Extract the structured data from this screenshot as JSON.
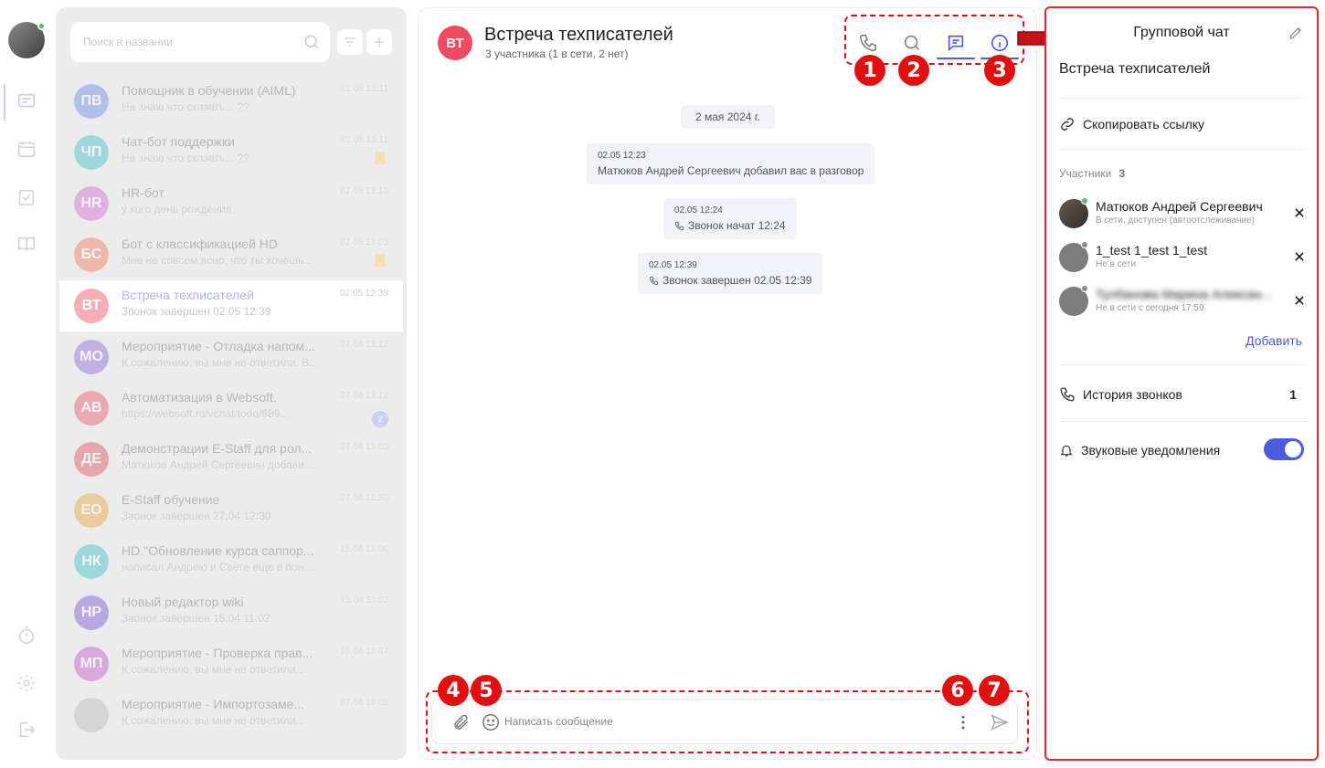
{
  "colors": {
    "accent": "#4a5ce0",
    "annotation_red": "#e01010",
    "online": "#4fc06a",
    "active_chat_avatar": "#ef4b5e"
  },
  "rail": {
    "icons": [
      "chat-icon",
      "calendar-icon",
      "tasks-icon",
      "book-icon",
      "timer-icon",
      "gear-icon",
      "logout-icon"
    ]
  },
  "chat_list": {
    "search_placeholder": "Поиск в названии",
    "items": [
      {
        "initials": "ПВ",
        "name": "Помощник в обучении (AIML)",
        "preview": "Не знаю что сказать... ??",
        "time": "02.05 13:11",
        "color": "#6b8bf0"
      },
      {
        "initials": "ЧП",
        "name": "Чат-бот поддержки",
        "preview": "Не знаю что сказать... ??",
        "time": "02.05 13:11",
        "color": "#3ec4c9",
        "bookmark": true
      },
      {
        "initials": "HR",
        "name": "HR-бот",
        "preview": "у кого день рождения",
        "time": "02.05 13:10",
        "color": "#d36ad0"
      },
      {
        "initials": "БС",
        "name": "Бот с классификацией HD",
        "preview": "Мне не совсем ясно, что ты хочешь...",
        "time": "02.05 13:03",
        "color": "#f07a5a",
        "bookmark": true
      },
      {
        "initials": "ВТ",
        "name": "Встреча техписателей",
        "preview": "Звонок завершен 02.05 12:39",
        "time": "02.05 12:39",
        "color": "#ef4b5e",
        "active": true
      },
      {
        "initials": "МО",
        "name": "Мероприятие - Отладка напом...",
        "preview": "К сожалению, вы мне не ответили. В...",
        "time": "27.04 13:12",
        "color": "#8a6ad6"
      },
      {
        "initials": "АВ",
        "name": "Автоматизация в Websoft.",
        "preview": "https://websoft.ru/vchat/todo/689...",
        "time": "27.04 13:12",
        "color": "#f05a6e",
        "badge": "2"
      },
      {
        "initials": "ДЕ",
        "name": "Демонстрации E-Staff для рол...",
        "preview": "Матюков Андрей Сергеевич добави...",
        "time": "27.04 13:05",
        "color": "#e0535b"
      },
      {
        "initials": "ЕО",
        "name": "E-Staff обучение",
        "preview": "Звонок завершен 27.04 12:30",
        "time": "27.04 12:30",
        "color": "#e8a43a"
      },
      {
        "initials": "НК",
        "name": "HD.\"Обновление курса саппор...",
        "preview": "написал Андрею и Свете еще в пон...",
        "time": "15.04 13:06",
        "color": "#3ec4c9"
      },
      {
        "initials": "НР",
        "name": "Новый редактор wiki",
        "preview": "Звонок завершен 15.04 11:02",
        "time": "15.04 11:02",
        "color": "#7a5ad6"
      },
      {
        "initials": "МП",
        "name": "Мероприятие - Проверка прав...",
        "preview": "К сожалению, вы мне не ответили...",
        "time": "10.04 10:07",
        "color": "#c45ac9"
      },
      {
        "initials": "",
        "name": "Мероприятие - Импортозаме...",
        "preview": "К сожалению, вы мне не ответили...",
        "time": "07.04 10:08",
        "color": "#bbbbbb"
      }
    ]
  },
  "chat": {
    "avatar_initials": "ВТ",
    "title": "Встреча техписателей",
    "subtitle": "3 участника (1 в сети, 2 нет)",
    "date_divider": "2 мая 2024 г.",
    "messages": [
      {
        "time": "02.05 12:23",
        "text": "Матюков Андрей Сергеевич добавил вас в разговор",
        "phone": false
      },
      {
        "time": "02.05 12:24",
        "text": "Звонок начат 12:24",
        "phone": true
      },
      {
        "time": "02.05 12:39",
        "text": "Звонок завершен 02.05 12:39",
        "phone": true
      }
    ],
    "composer_placeholder": "Написать сообщение"
  },
  "annotations": [
    "1",
    "2",
    "3",
    "4",
    "5",
    "6",
    "7"
  ],
  "info_panel": {
    "title": "Групповой чат",
    "chat_name": "Встреча техписателей",
    "copy_link": "Скопировать ссылку",
    "participants_label": "Участники",
    "participants_count": "3",
    "members": [
      {
        "name": "Матюков Андрей Сергеевич",
        "status": "В сети, доступен (автоотслеживание)",
        "online": true
      },
      {
        "name": "1_test 1_test 1_test",
        "status": "Не в сети",
        "online": false
      },
      {
        "name": "Тулбанова Марина Алексан...",
        "status": "Не в сети с сегодня 17:59",
        "online": false,
        "blurred": true
      }
    ],
    "add_label": "Добавить",
    "call_history": "История звонков",
    "call_history_count": "1",
    "sound_notifications": "Звуковые уведомления",
    "sound_enabled": true
  }
}
